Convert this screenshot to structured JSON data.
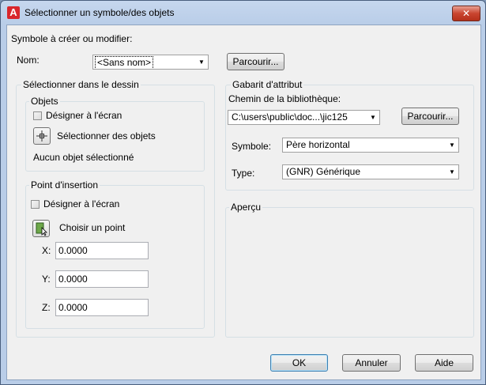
{
  "window": {
    "title": "Sélectionner un symbole/des objets",
    "close_glyph": "✕",
    "app_icon_glyph": "A"
  },
  "symbol_section": {
    "heading": "Symbole à créer ou modifier:",
    "name_label": "Nom:",
    "name_value": "<Sans nom>",
    "browse_label": "Parcourir..."
  },
  "select_in_drawing": {
    "heading": "Sélectionner dans le dessin",
    "objects": {
      "heading": "Objets",
      "designate_label": "Désigner à l'écran",
      "select_objects_label": "Sélectionner des objets",
      "status": "Aucun objet sélectionné"
    },
    "insertion_point": {
      "heading": "Point d'insertion",
      "designate_label": "Désigner à l'écran",
      "pick_point_label": "Choisir un point",
      "x_label": "X:",
      "x_value": "0.0000",
      "y_label": "Y:",
      "y_value": "0.0000",
      "z_label": "Z:",
      "z_value": "0.0000"
    }
  },
  "attribute_template": {
    "heading": "Gabarit d'attribut",
    "library_path_label": "Chemin de la bibliothèque:",
    "library_path_value": "C:\\users\\public\\doc...\\jic125",
    "browse_label": "Parcourir...",
    "symbol_label": "Symbole:",
    "symbol_value": "Père horizontal",
    "type_label": "Type:",
    "type_value": "(GNR) Générique"
  },
  "preview": {
    "heading": "Aperçu"
  },
  "footer": {
    "ok_label": "OK",
    "cancel_label": "Annuler",
    "help_label": "Aide"
  },
  "colors": {
    "title_bar": "#b9cde8",
    "client_bg": "#f0f0f0",
    "app_icon": "#d9262c",
    "close_button": "#c9452f"
  }
}
